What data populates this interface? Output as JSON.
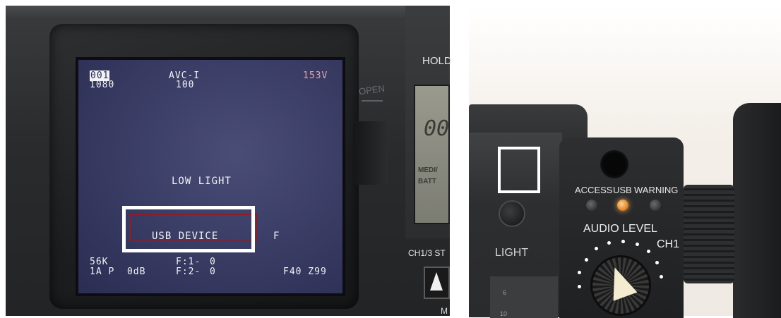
{
  "left_photo": {
    "lcd": {
      "top_left_badge": "001",
      "top_left_sub": "1080",
      "top_center": "AVC-I",
      "top_center_sub": "100",
      "top_right": "153V",
      "center_message": "LOW LIGHT",
      "highlight_message": "USB DEVICE",
      "right_flag": "F",
      "bottom_left_line1": "56K",
      "bottom_left_line2": "1A P  0dB",
      "f1_label": "F:1-",
      "f1_value": "0",
      "f2_label": "F:2-",
      "f2_value": "0",
      "bottom_right": "F40 Z99"
    },
    "body_labels": {
      "open": "OPEN",
      "hold": "HOLD",
      "lcd_digits": "00",
      "media": "MEDI/",
      "batt": "BATT",
      "ch_switch": "CH1/3 ST",
      "m": "M"
    },
    "highlight_box_color": "#ffffff",
    "highlight_inner_color": "#8a1f28"
  },
  "right_photo": {
    "light_label": "LIGHT",
    "status_labels": [
      "ACCESS",
      "USB",
      "WARNING"
    ],
    "usb_led_color": "#e08a2c",
    "audio_level": "AUDIO LEVEL",
    "ch1": "CH1",
    "meter_marks": [
      "6",
      "10"
    ],
    "highlight_box_color": "#ffffff"
  }
}
